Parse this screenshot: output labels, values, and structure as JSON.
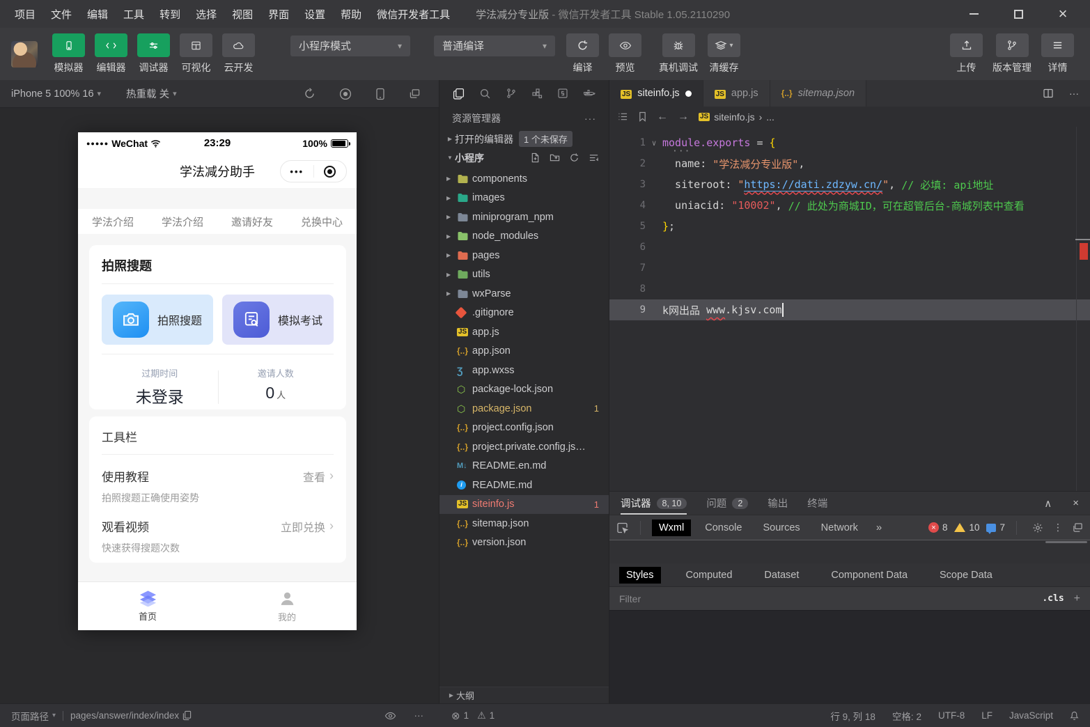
{
  "icons": {
    "caret_down": "▾",
    "arrow_right": "▶",
    "arrow_down": "▼",
    "chevron_right": "›",
    "fold": "∨",
    "close": "×",
    "collapse": "∧",
    "guillemet": "»",
    "vdots": "⋮",
    "ellipsis": "···",
    "error_circle": "⊗",
    "warning_tri": "⚠",
    "js_label": "JS",
    "json_label": "{..}",
    "wxss_label": "Ʒ",
    "npm_label": "⬡",
    "md_label": "M↓",
    "info_label": "i",
    "left_arrow": "←",
    "right_arrow": "→",
    "plus": "+"
  },
  "window": {
    "menus": [
      "项目",
      "文件",
      "编辑",
      "工具",
      "转到",
      "选择",
      "视图",
      "界面",
      "设置",
      "帮助",
      "微信开发者工具"
    ],
    "title": "学法减分专业版",
    "title_suffix": "- 微信开发者工具 Stable 1.05.2110290"
  },
  "toolbar": {
    "primary": [
      {
        "label": "模拟器",
        "icon": "phone",
        "active": true
      },
      {
        "label": "编辑器",
        "icon": "code",
        "active": true
      },
      {
        "label": "调试器",
        "icon": "sliders",
        "active": true
      },
      {
        "label": "可视化",
        "icon": "layout",
        "active": false
      },
      {
        "label": "云开发",
        "icon": "cloud",
        "active": false
      }
    ],
    "mode_select": "小程序模式",
    "compile_select": "普通编译",
    "compile_label": "编译",
    "preview_label": "预览",
    "device_debug_label": "真机调试",
    "clear_cache_label": "清缓存",
    "upload_label": "上传",
    "version_label": "版本管理",
    "detail_label": "详情"
  },
  "simulator": {
    "device_select": "iPhone 5 100% 16",
    "hot_reload": "热重载 关",
    "phone": {
      "signal": "●●●●●",
      "carrier": "WeChat",
      "time": "23:29",
      "battery": "100%",
      "nav_title": "学法减分助手",
      "capsule_dots": "•••",
      "tabs": [
        "学法介绍",
        "学法介绍",
        "邀请好友",
        "兑换中心"
      ],
      "photo_card": {
        "title": "拍照搜题",
        "actions": [
          {
            "label": "拍照搜题",
            "icon": "camera"
          },
          {
            "label": "模拟考试",
            "icon": "exam"
          }
        ],
        "stats": [
          {
            "label": "过期时间",
            "value": "未登录",
            "unit": ""
          },
          {
            "label": "邀请人数",
            "value": "0",
            "unit": "人"
          }
        ]
      },
      "tool_card": {
        "title": "工具栏",
        "rows": [
          {
            "title": "使用教程",
            "action": "查看",
            "sub": "拍照搜题正确使用姿势"
          },
          {
            "title": "观看视频",
            "action": "立即兑换",
            "sub": "快速获得搜题次数"
          }
        ]
      },
      "tabbar": [
        {
          "label": "首页",
          "icon": "home",
          "active": true
        },
        {
          "label": "我的",
          "icon": "user",
          "active": false
        }
      ]
    }
  },
  "explorer": {
    "panel_title": "资源管理器",
    "more": "···",
    "open_editors": "打开的编辑器",
    "unsaved_badge": "1 个未保存",
    "project_name": "小程序",
    "tree": [
      {
        "name": "components",
        "kind": "folder",
        "color": "#b2b24f"
      },
      {
        "name": "images",
        "kind": "folder",
        "color": "#2aa889"
      },
      {
        "name": "miniprogram_npm",
        "kind": "folder",
        "color": "#7d8796"
      },
      {
        "name": "node_modules",
        "kind": "folder",
        "color": "#8ac26a"
      },
      {
        "name": "pages",
        "kind": "folder",
        "color": "#e06c50"
      },
      {
        "name": "utils",
        "kind": "folder",
        "color": "#6faa5e"
      },
      {
        "name": "wxParse",
        "kind": "folder",
        "color": "#7d8796"
      },
      {
        "name": ".gitignore",
        "kind": "git"
      },
      {
        "name": "app.js",
        "kind": "js"
      },
      {
        "name": "app.json",
        "kind": "json"
      },
      {
        "name": "app.wxss",
        "kind": "wxss"
      },
      {
        "name": "package-lock.json",
        "kind": "npm"
      },
      {
        "name": "package.json",
        "kind": "npm",
        "badge": "1",
        "state": "modified"
      },
      {
        "name": "project.config.json",
        "kind": "json"
      },
      {
        "name": "project.private.config.js…",
        "kind": "json"
      },
      {
        "name": "README.en.md",
        "kind": "md"
      },
      {
        "name": "README.md",
        "kind": "info"
      },
      {
        "name": "siteinfo.js",
        "kind": "js",
        "badge": "1",
        "state": "error",
        "selected": true
      },
      {
        "name": "sitemap.json",
        "kind": "json"
      },
      {
        "name": "version.json",
        "kind": "json"
      }
    ],
    "outline": "大纲"
  },
  "editor": {
    "tabs": [
      {
        "name": "siteinfo.js",
        "icon": "js",
        "dirty": true,
        "active": true
      },
      {
        "name": "app.js",
        "icon": "js"
      },
      {
        "name": "sitemap.json",
        "icon": "json",
        "preview": true
      }
    ],
    "breadcrumb": {
      "file": "siteinfo.js",
      "more": "..."
    },
    "code": [
      {
        "fold": true,
        "dots": true,
        "tokens": [
          [
            "module.exports",
            "prop"
          ],
          [
            " = ",
            "plain"
          ],
          [
            "{",
            "brace"
          ]
        ]
      },
      {
        "tokens": [
          [
            "  name",
            "plain"
          ],
          [
            ": ",
            "plain"
          ],
          [
            "\"学法减分专业版\"",
            "str"
          ],
          [
            ",",
            "plain"
          ]
        ]
      },
      {
        "tokens": [
          [
            "  siteroot",
            "plain"
          ],
          [
            ": ",
            "plain"
          ],
          [
            "\"",
            "str"
          ],
          [
            "https://dati.zdzyw.cn/",
            "link"
          ],
          [
            "\"",
            "str"
          ],
          [
            ", ",
            "plain"
          ],
          [
            "// 必填: api地址",
            "com"
          ]
        ]
      },
      {
        "tokens": [
          [
            "  uniacid",
            "plain"
          ],
          [
            ": ",
            "plain"
          ],
          [
            "\"10002\"",
            "red"
          ],
          [
            ", ",
            "plain"
          ],
          [
            "// 此处为商城ID，可在超管后台-商城列表中查看",
            "com"
          ]
        ]
      },
      {
        "tokens": [
          [
            "}",
            "brace"
          ],
          [
            ";",
            "plain"
          ]
        ]
      },
      {
        "tokens": []
      },
      {
        "tokens": []
      },
      {
        "tokens": []
      },
      {
        "selected": true,
        "cursor": true,
        "tokens": [
          [
            "k网出品 ",
            "sel"
          ],
          [
            "www",
            "sel squig"
          ],
          [
            ".kjsv.com",
            "sel"
          ]
        ]
      }
    ]
  },
  "debugger": {
    "tabs": [
      {
        "label": "调试器",
        "badge": "8, 10",
        "active": true
      },
      {
        "label": "问题",
        "badge": "2"
      },
      {
        "label": "输出"
      },
      {
        "label": "终端"
      }
    ],
    "devtools": {
      "tabs": [
        {
          "label": "Wxml",
          "active": true
        },
        {
          "label": "Console"
        },
        {
          "label": "Sources"
        },
        {
          "label": "Network"
        }
      ],
      "errors": "8",
      "warnings": "10",
      "messages": "7"
    },
    "styles_tabs": [
      {
        "label": "Styles",
        "active": true
      },
      {
        "label": "Computed"
      },
      {
        "label": "Dataset"
      },
      {
        "label": "Component Data"
      },
      {
        "label": "Scope Data"
      }
    ],
    "filter_placeholder": "Filter",
    "cls_label": ".cls"
  },
  "statusbar": {
    "page_path_label": "页面路径",
    "page_path": "pages/answer/index/index",
    "errors": "1",
    "warnings": "1",
    "cursor": "行 9, 列 18",
    "indent": "空格: 2",
    "encoding": "UTF-8",
    "eol": "LF",
    "language": "JavaScript"
  }
}
